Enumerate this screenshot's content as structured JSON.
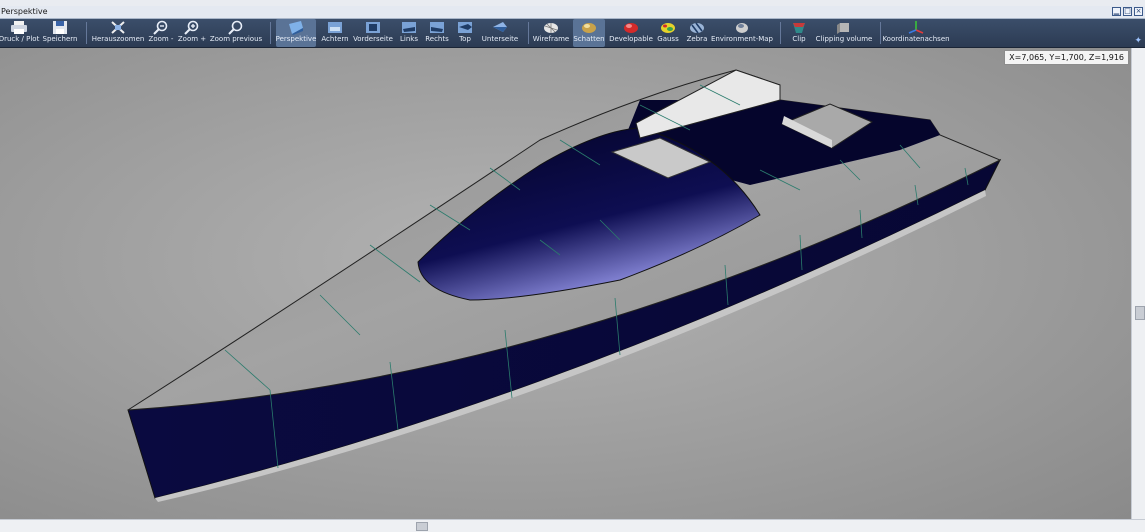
{
  "window": {
    "title": "Perspektive"
  },
  "toolbar": {
    "items": [
      {
        "label": "Druck / Plot",
        "icon": "printer-icon"
      },
      {
        "label": "Speichern",
        "icon": "save-icon"
      },
      {
        "label": "Herauszoomen",
        "icon": "zoom-extents-icon"
      },
      {
        "label": "Zoom -",
        "icon": "zoom-out-icon"
      },
      {
        "label": "Zoom +",
        "icon": "zoom-in-icon"
      },
      {
        "label": "Zoom previous",
        "icon": "zoom-previous-icon"
      },
      {
        "label": "Perspektive",
        "icon": "perspective-view-icon"
      },
      {
        "label": "Achtern",
        "icon": "aft-view-icon"
      },
      {
        "label": "Vorderseite",
        "icon": "front-view-icon"
      },
      {
        "label": "Links",
        "icon": "left-view-icon"
      },
      {
        "label": "Rechts",
        "icon": "right-view-icon"
      },
      {
        "label": "Top",
        "icon": "top-view-icon"
      },
      {
        "label": "Unterseite",
        "icon": "bottom-view-icon"
      },
      {
        "label": "Wireframe",
        "icon": "wireframe-icon"
      },
      {
        "label": "Schatten",
        "icon": "shade-icon"
      },
      {
        "label": "Developable",
        "icon": "developable-icon"
      },
      {
        "label": "Gauss",
        "icon": "gauss-icon"
      },
      {
        "label": "Zebra",
        "icon": "zebra-icon"
      },
      {
        "label": "Environment-Map",
        "icon": "environment-map-icon"
      },
      {
        "label": "Clip",
        "icon": "clip-icon"
      },
      {
        "label": "Clipping volume",
        "icon": "clipping-volume-icon"
      },
      {
        "label": "Koordinatenachsen",
        "icon": "axes-icon"
      }
    ]
  },
  "viewport": {
    "coordinates": "X=7,065, Y=1,700, Z=1,916"
  },
  "colors": {
    "hull_dark": "#0a0a3c",
    "hull_side": "#0b0b45",
    "deck": "#9c9c9c",
    "toolbar": "#33445f",
    "active": "#5a7396"
  }
}
